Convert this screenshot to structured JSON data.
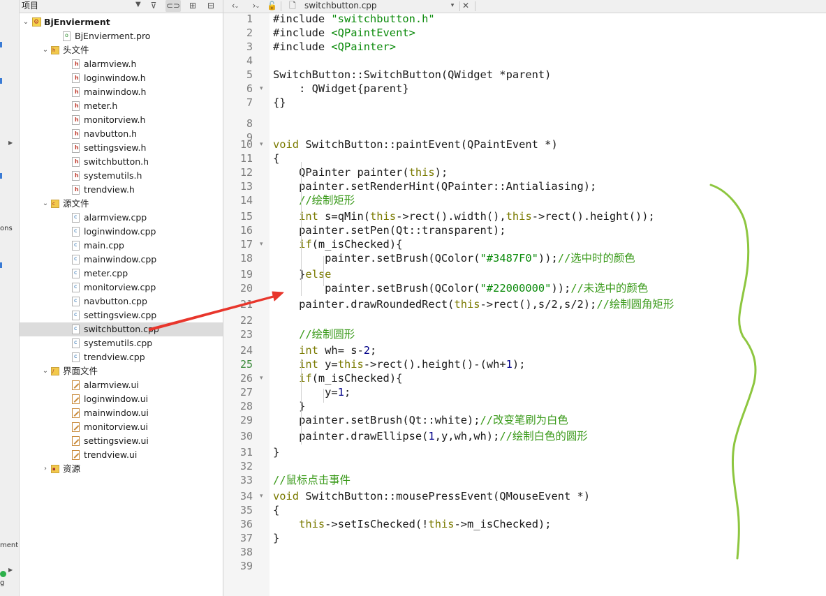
{
  "mode_strip": {
    "fragments": [
      "ons",
      "ment",
      "g"
    ]
  },
  "tree": {
    "header_title": "项目",
    "rows": [
      {
        "label": "BjEnvierment",
        "kind": "project",
        "depth": 0,
        "expanded": true,
        "bold": true
      },
      {
        "label": "BjEnvierment.pro",
        "kind": "pro",
        "depth": 1
      },
      {
        "label": "头文件",
        "kind": "folder-h",
        "depth": 1,
        "expanded": true
      },
      {
        "label": "alarmview.h",
        "kind": "h",
        "depth": 2
      },
      {
        "label": "loginwindow.h",
        "kind": "h",
        "depth": 2
      },
      {
        "label": "mainwindow.h",
        "kind": "h",
        "depth": 2
      },
      {
        "label": "meter.h",
        "kind": "h",
        "depth": 2
      },
      {
        "label": "monitorview.h",
        "kind": "h",
        "depth": 2
      },
      {
        "label": "navbutton.h",
        "kind": "h",
        "depth": 2
      },
      {
        "label": "settingsview.h",
        "kind": "h",
        "depth": 2
      },
      {
        "label": "switchbutton.h",
        "kind": "h",
        "depth": 2
      },
      {
        "label": "systemutils.h",
        "kind": "h",
        "depth": 2
      },
      {
        "label": "trendview.h",
        "kind": "h",
        "depth": 2
      },
      {
        "label": "源文件",
        "kind": "folder-cpp",
        "depth": 1,
        "expanded": true
      },
      {
        "label": "alarmview.cpp",
        "kind": "cpp",
        "depth": 2
      },
      {
        "label": "loginwindow.cpp",
        "kind": "cpp",
        "depth": 2
      },
      {
        "label": "main.cpp",
        "kind": "cpp",
        "depth": 2
      },
      {
        "label": "mainwindow.cpp",
        "kind": "cpp",
        "depth": 2
      },
      {
        "label": "meter.cpp",
        "kind": "cpp",
        "depth": 2
      },
      {
        "label": "monitorview.cpp",
        "kind": "cpp",
        "depth": 2
      },
      {
        "label": "navbutton.cpp",
        "kind": "cpp",
        "depth": 2
      },
      {
        "label": "settingsview.cpp",
        "kind": "cpp",
        "depth": 2
      },
      {
        "label": "switchbutton.cpp",
        "kind": "cpp",
        "depth": 2,
        "selected": true
      },
      {
        "label": "systemutils.cpp",
        "kind": "cpp",
        "depth": 2
      },
      {
        "label": "trendview.cpp",
        "kind": "cpp",
        "depth": 2
      },
      {
        "label": "界面文件",
        "kind": "folder-ui",
        "depth": 1,
        "expanded": true
      },
      {
        "label": "alarmview.ui",
        "kind": "ui",
        "depth": 2
      },
      {
        "label": "loginwindow.ui",
        "kind": "ui",
        "depth": 2
      },
      {
        "label": "mainwindow.ui",
        "kind": "ui",
        "depth": 2
      },
      {
        "label": "monitorview.ui",
        "kind": "ui",
        "depth": 2
      },
      {
        "label": "settingsview.ui",
        "kind": "ui",
        "depth": 2
      },
      {
        "label": "trendview.ui",
        "kind": "ui",
        "depth": 2
      },
      {
        "label": "资源",
        "kind": "folder-res",
        "depth": 1,
        "expanded": false
      }
    ]
  },
  "editor": {
    "file_name": "switchbutton.cpp",
    "current_line": 25,
    "lines": [
      {
        "n": "1",
        "segs": [
          [
            "t",
            "#include "
          ],
          [
            "str",
            "\"switchbutton.h\""
          ]
        ]
      },
      {
        "n": "2",
        "segs": [
          [
            "t",
            "#include "
          ],
          [
            "str",
            "<QPaintEvent>"
          ]
        ]
      },
      {
        "n": "3",
        "segs": [
          [
            "t",
            "#include "
          ],
          [
            "str",
            "<QPainter>"
          ]
        ]
      },
      {
        "n": "4",
        "segs": []
      },
      {
        "n": "5",
        "segs": [
          [
            "t",
            "SwitchButton::SwitchButton(QWidget *parent)"
          ]
        ]
      },
      {
        "n": "6",
        "segs": [
          [
            "t",
            "    : QWidget{parent}"
          ]
        ],
        "fold": true
      },
      {
        "n": "7",
        "segs": [
          [
            "t",
            "{}"
          ]
        ]
      },
      {
        "n": "8",
        "segs": []
      },
      {
        "n": "9",
        "segs": []
      },
      {
        "n": "10",
        "segs": [
          [
            "kw",
            "void"
          ],
          [
            "t",
            " SwitchButton::paintEvent(QPaintEvent *)"
          ]
        ],
        "fold": true
      },
      {
        "n": "11",
        "segs": [
          [
            "t",
            "{"
          ]
        ]
      },
      {
        "n": "12",
        "segs": [
          [
            "t",
            "    QPainter painter("
          ],
          [
            "kw",
            "this"
          ],
          [
            "t",
            ");"
          ]
        ]
      },
      {
        "n": "13",
        "segs": [
          [
            "t",
            "    painter.setRenderHint(QPainter::Antialiasing);"
          ]
        ]
      },
      {
        "n": "14",
        "segs": [
          [
            "cmt",
            "    //绘制矩形"
          ]
        ]
      },
      {
        "n": "15",
        "segs": [
          [
            "t",
            "    "
          ],
          [
            "kw",
            "int"
          ],
          [
            "t",
            " s=qMin("
          ],
          [
            "kw",
            "this"
          ],
          [
            "t",
            "->rect().width(),"
          ],
          [
            "kw",
            "this"
          ],
          [
            "t",
            "->rect().height());"
          ]
        ]
      },
      {
        "n": "16",
        "segs": [
          [
            "t",
            "    painter.setPen(Qt::transparent);"
          ]
        ]
      },
      {
        "n": "17",
        "segs": [
          [
            "t",
            "    "
          ],
          [
            "kw",
            "if"
          ],
          [
            "t",
            "(m_isChecked){"
          ]
        ],
        "fold": true
      },
      {
        "n": "18",
        "segs": [
          [
            "t",
            "        painter.setBrush(QColor("
          ],
          [
            "str",
            "\"#3487F0\""
          ],
          [
            "t",
            "));"
          ],
          [
            "cmt",
            "//选中时的颜色"
          ]
        ]
      },
      {
        "n": "19",
        "segs": [
          [
            "t",
            "    }"
          ],
          [
            "kw",
            "else"
          ]
        ]
      },
      {
        "n": "20",
        "segs": [
          [
            "t",
            "        painter.setBrush(QColor("
          ],
          [
            "str",
            "\"#22000000\""
          ],
          [
            "t",
            "));"
          ],
          [
            "cmt",
            "//未选中的颜色"
          ]
        ]
      },
      {
        "n": "21",
        "segs": [
          [
            "t",
            "    painter.drawRoundedRect("
          ],
          [
            "kw",
            "this"
          ],
          [
            "t",
            "->rect(),s/2,s/2);"
          ],
          [
            "cmt",
            "//绘制圆角矩形"
          ]
        ]
      },
      {
        "n": "22",
        "segs": []
      },
      {
        "n": "23",
        "segs": [
          [
            "cmt",
            "    //绘制圆形"
          ]
        ]
      },
      {
        "n": "24",
        "segs": [
          [
            "t",
            "    "
          ],
          [
            "kw",
            "int"
          ],
          [
            "t",
            " wh= s-"
          ],
          [
            "num",
            "2"
          ],
          [
            "t",
            ";"
          ]
        ]
      },
      {
        "n": "25",
        "segs": [
          [
            "t",
            "    "
          ],
          [
            "kw",
            "int"
          ],
          [
            "t",
            " y="
          ],
          [
            "kw",
            "this"
          ],
          [
            "t",
            "->rect().height()-(wh+"
          ],
          [
            "num",
            "1"
          ],
          [
            "t",
            ");"
          ]
        ]
      },
      {
        "n": "26",
        "segs": [
          [
            "t",
            "    "
          ],
          [
            "kw",
            "if"
          ],
          [
            "t",
            "(m_isChecked){"
          ]
        ],
        "fold": true
      },
      {
        "n": "27",
        "segs": [
          [
            "t",
            "        y="
          ],
          [
            "num",
            "1"
          ],
          [
            "t",
            ";"
          ]
        ]
      },
      {
        "n": "28",
        "segs": [
          [
            "t",
            "    }"
          ]
        ]
      },
      {
        "n": "29",
        "segs": [
          [
            "t",
            "    painter.setBrush(Qt::white);"
          ],
          [
            "cmt",
            "//改变笔刷为白色"
          ]
        ]
      },
      {
        "n": "30",
        "segs": [
          [
            "t",
            "    painter.drawEllipse("
          ],
          [
            "num",
            "1"
          ],
          [
            "t",
            ",y,wh,wh);"
          ],
          [
            "cmt",
            "//绘制白色的圆形"
          ]
        ]
      },
      {
        "n": "31",
        "segs": [
          [
            "t",
            "}"
          ]
        ]
      },
      {
        "n": "32",
        "segs": []
      },
      {
        "n": "33",
        "segs": [
          [
            "cmt",
            "//鼠标点击事件"
          ]
        ]
      },
      {
        "n": "34",
        "segs": [
          [
            "kw",
            "void"
          ],
          [
            "t",
            " SwitchButton::mousePressEvent(QMouseEvent *)"
          ]
        ],
        "fold": true
      },
      {
        "n": "35",
        "segs": [
          [
            "t",
            "{"
          ]
        ]
      },
      {
        "n": "36",
        "segs": [
          [
            "t",
            "    "
          ],
          [
            "kw",
            "this"
          ],
          [
            "t",
            "->setIsChecked(!"
          ],
          [
            "kw",
            "this"
          ],
          [
            "t",
            "->m_isChecked);"
          ]
        ]
      },
      {
        "n": "37",
        "segs": [
          [
            "t",
            "}"
          ]
        ]
      },
      {
        "n": "38",
        "segs": []
      },
      {
        "n": "39",
        "segs": []
      }
    ]
  },
  "colors": {
    "keyword": "#7a7a00",
    "string": "#0a8a0a",
    "comment": "#3a9a1a",
    "number": "#000088",
    "annotation_arrow": "#e8362c",
    "annotation_brace": "#8dc63f",
    "selection": "#dcdcdc"
  }
}
